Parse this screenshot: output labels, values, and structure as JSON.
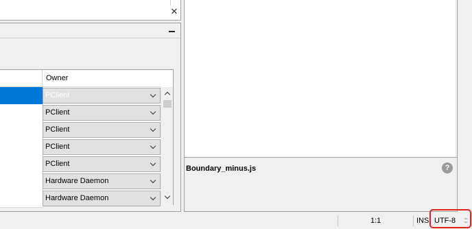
{
  "top_panel": {
    "close_glyph": "✕"
  },
  "table": {
    "header_owner": "Owner",
    "rows": [
      {
        "owner": "PClient",
        "selected": true
      },
      {
        "owner": "PClient",
        "selected": false
      },
      {
        "owner": "PClient",
        "selected": false
      },
      {
        "owner": "PClient",
        "selected": false
      },
      {
        "owner": "PClient",
        "selected": false
      },
      {
        "owner": "Hardware Daemon",
        "selected": false
      },
      {
        "owner": "Hardware Daemon",
        "selected": false
      }
    ]
  },
  "info_pane": {
    "filename": "Boundary_minus.js",
    "help_glyph": "?"
  },
  "statusbar": {
    "position": "1:1",
    "mode": "INS",
    "encoding": "UTF-8"
  },
  "colors": {
    "selection": "#0078d7",
    "highlight": "#e0241b"
  },
  "icons": {
    "close": "close-icon",
    "minimize": "minimize-icon",
    "dropdown": "chevron-down-icon",
    "help": "help-icon",
    "scroll_up": "chevron-up-icon",
    "scroll_down": "chevron-down-icon"
  }
}
